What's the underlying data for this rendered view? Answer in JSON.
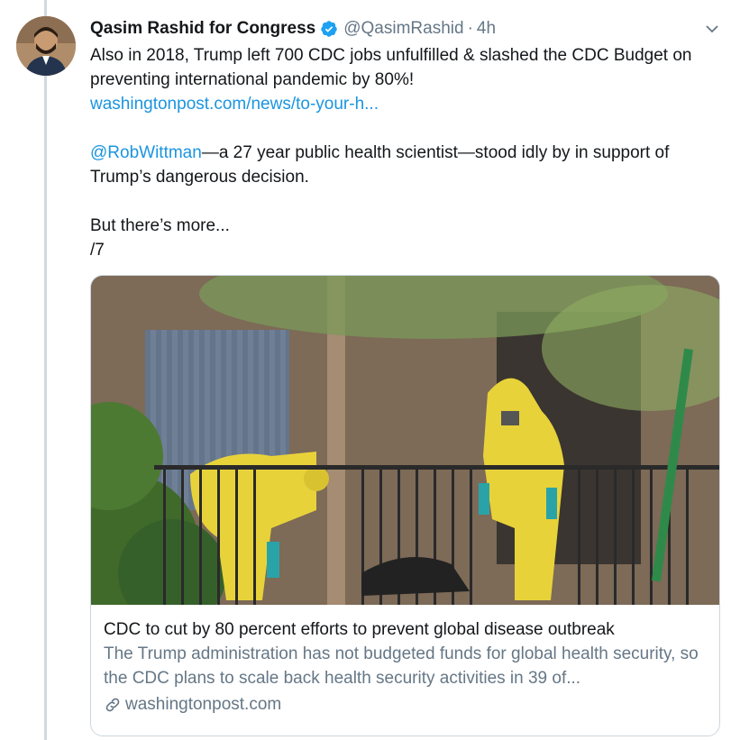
{
  "author": {
    "name": "Qasim Rashid for Congress",
    "handle": "@QasimRashid",
    "separator": "·",
    "time": "4h"
  },
  "tweet": {
    "line1": "Also in 2018, Trump left 700 CDC jobs unfulfilled & slashed the CDC Budget on preventing international pandemic by 80%!",
    "link": "washingtonpost.com/news/to-your-h...",
    "mention": "@RobWittman",
    "line2_rest": "—a 27 year public health scientist—stood idly by in support of Trump’s dangerous decision.",
    "line3": "But there’s more...",
    "line4": "/7"
  },
  "card": {
    "title": "CDC to cut by 80 percent efforts to prevent global disease outbreak",
    "description": "The Trump administration has not budgeted funds for global health security, so the CDC plans to scale back health security activities in 39 of...",
    "source": "washingtonpost.com"
  },
  "colors": {
    "link": "#1b95e0",
    "verified": "#1da1f2",
    "muted": "#657786",
    "hazmat": "#e8d23a"
  },
  "icons": {
    "verified": "verified-badge-icon",
    "chevron": "chevron-down-icon",
    "link": "link-icon"
  }
}
